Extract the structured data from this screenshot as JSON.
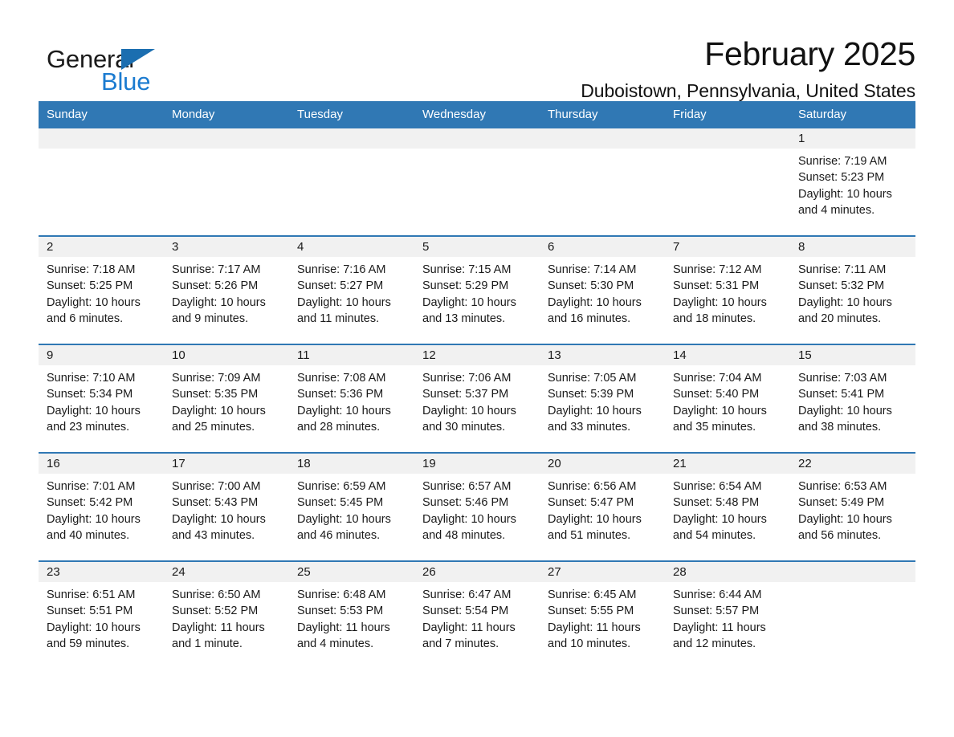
{
  "brand": {
    "name_part1": "General",
    "name_part2": "Blue",
    "triangle_icon": "brand-triangle-icon"
  },
  "header": {
    "month_title": "February 2025",
    "location": "Duboistown, Pennsylvania, United States"
  },
  "colors": {
    "header_blue": "#3078b4",
    "brand_blue": "#1b7bd0",
    "day_strip_gray": "#f1f1f1",
    "text": "#1a1a1a"
  },
  "weekdays": [
    "Sunday",
    "Monday",
    "Tuesday",
    "Wednesday",
    "Thursday",
    "Friday",
    "Saturday"
  ],
  "labels": {
    "sunrise": "Sunrise:",
    "sunset": "Sunset:",
    "daylight": "Daylight:"
  },
  "weeks": [
    [
      {
        "day": "",
        "sunrise": "",
        "sunset": "",
        "daylight": ""
      },
      {
        "day": "",
        "sunrise": "",
        "sunset": "",
        "daylight": ""
      },
      {
        "day": "",
        "sunrise": "",
        "sunset": "",
        "daylight": ""
      },
      {
        "day": "",
        "sunrise": "",
        "sunset": "",
        "daylight": ""
      },
      {
        "day": "",
        "sunrise": "",
        "sunset": "",
        "daylight": ""
      },
      {
        "day": "",
        "sunrise": "",
        "sunset": "",
        "daylight": ""
      },
      {
        "day": "1",
        "sunrise": "Sunrise: 7:19 AM",
        "sunset": "Sunset: 5:23 PM",
        "daylight": "Daylight: 10 hours and 4 minutes."
      }
    ],
    [
      {
        "day": "2",
        "sunrise": "Sunrise: 7:18 AM",
        "sunset": "Sunset: 5:25 PM",
        "daylight": "Daylight: 10 hours and 6 minutes."
      },
      {
        "day": "3",
        "sunrise": "Sunrise: 7:17 AM",
        "sunset": "Sunset: 5:26 PM",
        "daylight": "Daylight: 10 hours and 9 minutes."
      },
      {
        "day": "4",
        "sunrise": "Sunrise: 7:16 AM",
        "sunset": "Sunset: 5:27 PM",
        "daylight": "Daylight: 10 hours and 11 minutes."
      },
      {
        "day": "5",
        "sunrise": "Sunrise: 7:15 AM",
        "sunset": "Sunset: 5:29 PM",
        "daylight": "Daylight: 10 hours and 13 minutes."
      },
      {
        "day": "6",
        "sunrise": "Sunrise: 7:14 AM",
        "sunset": "Sunset: 5:30 PM",
        "daylight": "Daylight: 10 hours and 16 minutes."
      },
      {
        "day": "7",
        "sunrise": "Sunrise: 7:12 AM",
        "sunset": "Sunset: 5:31 PM",
        "daylight": "Daylight: 10 hours and 18 minutes."
      },
      {
        "day": "8",
        "sunrise": "Sunrise: 7:11 AM",
        "sunset": "Sunset: 5:32 PM",
        "daylight": "Daylight: 10 hours and 20 minutes."
      }
    ],
    [
      {
        "day": "9",
        "sunrise": "Sunrise: 7:10 AM",
        "sunset": "Sunset: 5:34 PM",
        "daylight": "Daylight: 10 hours and 23 minutes."
      },
      {
        "day": "10",
        "sunrise": "Sunrise: 7:09 AM",
        "sunset": "Sunset: 5:35 PM",
        "daylight": "Daylight: 10 hours and 25 minutes."
      },
      {
        "day": "11",
        "sunrise": "Sunrise: 7:08 AM",
        "sunset": "Sunset: 5:36 PM",
        "daylight": "Daylight: 10 hours and 28 minutes."
      },
      {
        "day": "12",
        "sunrise": "Sunrise: 7:06 AM",
        "sunset": "Sunset: 5:37 PM",
        "daylight": "Daylight: 10 hours and 30 minutes."
      },
      {
        "day": "13",
        "sunrise": "Sunrise: 7:05 AM",
        "sunset": "Sunset: 5:39 PM",
        "daylight": "Daylight: 10 hours and 33 minutes."
      },
      {
        "day": "14",
        "sunrise": "Sunrise: 7:04 AM",
        "sunset": "Sunset: 5:40 PM",
        "daylight": "Daylight: 10 hours and 35 minutes."
      },
      {
        "day": "15",
        "sunrise": "Sunrise: 7:03 AM",
        "sunset": "Sunset: 5:41 PM",
        "daylight": "Daylight: 10 hours and 38 minutes."
      }
    ],
    [
      {
        "day": "16",
        "sunrise": "Sunrise: 7:01 AM",
        "sunset": "Sunset: 5:42 PM",
        "daylight": "Daylight: 10 hours and 40 minutes."
      },
      {
        "day": "17",
        "sunrise": "Sunrise: 7:00 AM",
        "sunset": "Sunset: 5:43 PM",
        "daylight": "Daylight: 10 hours and 43 minutes."
      },
      {
        "day": "18",
        "sunrise": "Sunrise: 6:59 AM",
        "sunset": "Sunset: 5:45 PM",
        "daylight": "Daylight: 10 hours and 46 minutes."
      },
      {
        "day": "19",
        "sunrise": "Sunrise: 6:57 AM",
        "sunset": "Sunset: 5:46 PM",
        "daylight": "Daylight: 10 hours and 48 minutes."
      },
      {
        "day": "20",
        "sunrise": "Sunrise: 6:56 AM",
        "sunset": "Sunset: 5:47 PM",
        "daylight": "Daylight: 10 hours and 51 minutes."
      },
      {
        "day": "21",
        "sunrise": "Sunrise: 6:54 AM",
        "sunset": "Sunset: 5:48 PM",
        "daylight": "Daylight: 10 hours and 54 minutes."
      },
      {
        "day": "22",
        "sunrise": "Sunrise: 6:53 AM",
        "sunset": "Sunset: 5:49 PM",
        "daylight": "Daylight: 10 hours and 56 minutes."
      }
    ],
    [
      {
        "day": "23",
        "sunrise": "Sunrise: 6:51 AM",
        "sunset": "Sunset: 5:51 PM",
        "daylight": "Daylight: 10 hours and 59 minutes."
      },
      {
        "day": "24",
        "sunrise": "Sunrise: 6:50 AM",
        "sunset": "Sunset: 5:52 PM",
        "daylight": "Daylight: 11 hours and 1 minute."
      },
      {
        "day": "25",
        "sunrise": "Sunrise: 6:48 AM",
        "sunset": "Sunset: 5:53 PM",
        "daylight": "Daylight: 11 hours and 4 minutes."
      },
      {
        "day": "26",
        "sunrise": "Sunrise: 6:47 AM",
        "sunset": "Sunset: 5:54 PM",
        "daylight": "Daylight: 11 hours and 7 minutes."
      },
      {
        "day": "27",
        "sunrise": "Sunrise: 6:45 AM",
        "sunset": "Sunset: 5:55 PM",
        "daylight": "Daylight: 11 hours and 10 minutes."
      },
      {
        "day": "28",
        "sunrise": "Sunrise: 6:44 AM",
        "sunset": "Sunset: 5:57 PM",
        "daylight": "Daylight: 11 hours and 12 minutes."
      },
      {
        "day": "",
        "sunrise": "",
        "sunset": "",
        "daylight": ""
      }
    ]
  ]
}
